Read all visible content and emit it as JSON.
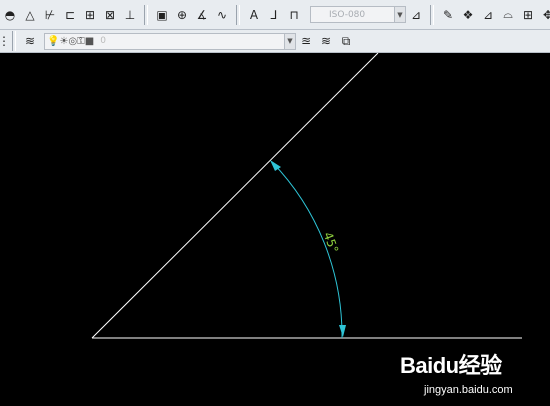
{
  "toolbar_top": {
    "dimstyle_combo": {
      "value": "ISO-080"
    },
    "tool_icons_left": [
      "ellipse-arc-icon",
      "triangle-icon",
      "dimension-linear-icon",
      "dimension-aligned-icon",
      "dimension-baseline-icon",
      "dimension-continue-icon",
      "dimension-center-icon",
      "tolerance-icon",
      "center-mark-icon",
      "angular-dim-icon",
      "jogged-dim-icon",
      "text-icon",
      "dim-edit-icon",
      "dim-style-icon"
    ],
    "tool_icons_right": [
      "dim-update-icon",
      "erase-icon",
      "copy-icon",
      "mirror-icon",
      "offset-icon",
      "array-icon",
      "move-icon",
      "rotate-icon"
    ]
  },
  "toolbar_layers": {
    "layer_combo": {
      "value": "0"
    },
    "layer_icons": [
      "layer-manager-icon",
      "make-current-icon",
      "layer-previous-icon"
    ]
  },
  "drawing": {
    "angle_label": "45°",
    "line_color": "#ffffff",
    "dim_color": "#2ec4d6",
    "text_color": "#8fd13f",
    "background": "#000000"
  },
  "watermark": {
    "logo_text": "Baidu经验",
    "url": "jingyan.baidu.com"
  }
}
